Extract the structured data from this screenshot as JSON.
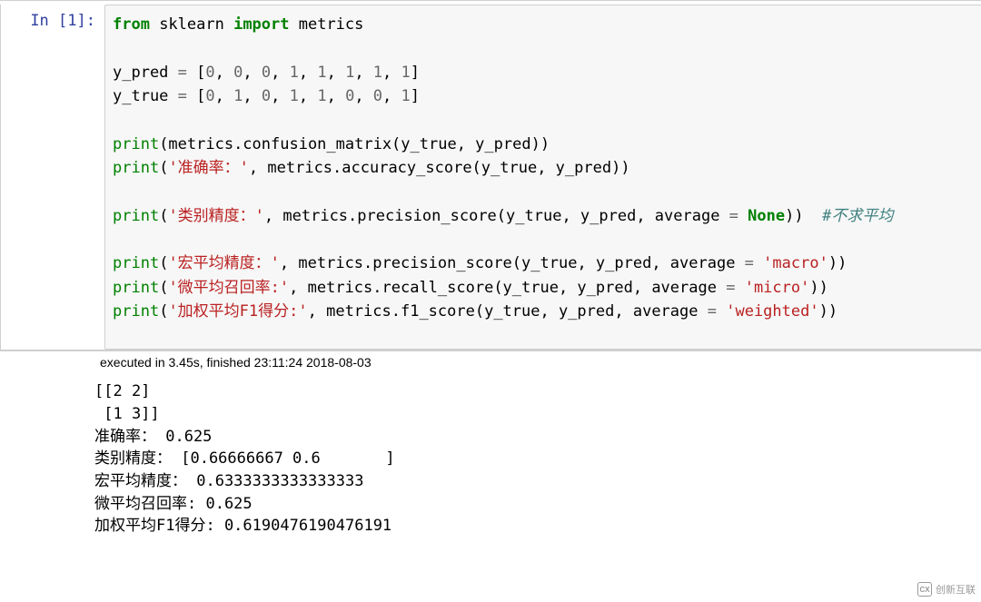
{
  "cell": {
    "prompt_label": "In",
    "prompt_number": "[1]:",
    "code_tokens": [
      {
        "cls": "kw-green",
        "t": "from"
      },
      {
        "cls": "plain",
        "t": " sklearn "
      },
      {
        "cls": "kw-green",
        "t": "import"
      },
      {
        "cls": "plain",
        "t": " metrics\n\n"
      },
      {
        "cls": "plain",
        "t": "y_pred "
      },
      {
        "cls": "op",
        "t": "="
      },
      {
        "cls": "plain",
        "t": " ["
      },
      {
        "cls": "op",
        "t": "0"
      },
      {
        "cls": "plain",
        "t": ", "
      },
      {
        "cls": "op",
        "t": "0"
      },
      {
        "cls": "plain",
        "t": ", "
      },
      {
        "cls": "op",
        "t": "0"
      },
      {
        "cls": "plain",
        "t": ", "
      },
      {
        "cls": "op",
        "t": "1"
      },
      {
        "cls": "plain",
        "t": ", "
      },
      {
        "cls": "op",
        "t": "1"
      },
      {
        "cls": "plain",
        "t": ", "
      },
      {
        "cls": "op",
        "t": "1"
      },
      {
        "cls": "plain",
        "t": ", "
      },
      {
        "cls": "op",
        "t": "1"
      },
      {
        "cls": "plain",
        "t": ", "
      },
      {
        "cls": "op",
        "t": "1"
      },
      {
        "cls": "plain",
        "t": "]\n"
      },
      {
        "cls": "plain",
        "t": "y_true "
      },
      {
        "cls": "op",
        "t": "="
      },
      {
        "cls": "plain",
        "t": " ["
      },
      {
        "cls": "op",
        "t": "0"
      },
      {
        "cls": "plain",
        "t": ", "
      },
      {
        "cls": "op",
        "t": "1"
      },
      {
        "cls": "plain",
        "t": ", "
      },
      {
        "cls": "op",
        "t": "0"
      },
      {
        "cls": "plain",
        "t": ", "
      },
      {
        "cls": "op",
        "t": "1"
      },
      {
        "cls": "plain",
        "t": ", "
      },
      {
        "cls": "op",
        "t": "1"
      },
      {
        "cls": "plain",
        "t": ", "
      },
      {
        "cls": "op",
        "t": "0"
      },
      {
        "cls": "plain",
        "t": ", "
      },
      {
        "cls": "op",
        "t": "0"
      },
      {
        "cls": "plain",
        "t": ", "
      },
      {
        "cls": "op",
        "t": "1"
      },
      {
        "cls": "plain",
        "t": "]\n\n"
      },
      {
        "cls": "builtin",
        "t": "print"
      },
      {
        "cls": "plain",
        "t": "(metrics.confusion_matrix(y_true, y_pred))\n"
      },
      {
        "cls": "builtin",
        "t": "print"
      },
      {
        "cls": "plain",
        "t": "("
      },
      {
        "cls": "str",
        "t": "'准确率：'"
      },
      {
        "cls": "plain",
        "t": ", metrics.accuracy_score(y_true, y_pred))\n\n"
      },
      {
        "cls": "builtin",
        "t": "print"
      },
      {
        "cls": "plain",
        "t": "("
      },
      {
        "cls": "str",
        "t": "'类别精度：'"
      },
      {
        "cls": "plain",
        "t": ", metrics.precision_score(y_true, y_pred, average "
      },
      {
        "cls": "op",
        "t": "="
      },
      {
        "cls": "plain",
        "t": " "
      },
      {
        "cls": "id-none",
        "t": "None"
      },
      {
        "cls": "plain",
        "t": "))  "
      },
      {
        "cls": "comment",
        "t": "#不求平均"
      },
      {
        "cls": "plain",
        "t": "\n\n"
      },
      {
        "cls": "builtin",
        "t": "print"
      },
      {
        "cls": "plain",
        "t": "("
      },
      {
        "cls": "str",
        "t": "'宏平均精度：'"
      },
      {
        "cls": "plain",
        "t": ", metrics.precision_score(y_true, y_pred, average "
      },
      {
        "cls": "op",
        "t": "="
      },
      {
        "cls": "plain",
        "t": " "
      },
      {
        "cls": "str",
        "t": "'macro'"
      },
      {
        "cls": "plain",
        "t": "))\n"
      },
      {
        "cls": "builtin",
        "t": "print"
      },
      {
        "cls": "plain",
        "t": "("
      },
      {
        "cls": "str",
        "t": "'微平均召回率:'"
      },
      {
        "cls": "plain",
        "t": ", metrics.recall_score(y_true, y_pred, average "
      },
      {
        "cls": "op",
        "t": "="
      },
      {
        "cls": "plain",
        "t": " "
      },
      {
        "cls": "str",
        "t": "'micro'"
      },
      {
        "cls": "plain",
        "t": "))\n"
      },
      {
        "cls": "builtin",
        "t": "print"
      },
      {
        "cls": "plain",
        "t": "("
      },
      {
        "cls": "str",
        "t": "'加权平均F1得分:'"
      },
      {
        "cls": "plain",
        "t": ", metrics.f1_score(y_true, y_pred, average "
      },
      {
        "cls": "op",
        "t": "="
      },
      {
        "cls": "plain",
        "t": " "
      },
      {
        "cls": "str",
        "t": "'weighted'"
      },
      {
        "cls": "plain",
        "t": "))"
      }
    ]
  },
  "exec_bar": "executed in 3.45s, finished 23:11:24 2018-08-03",
  "output": "[[2 2]\n [1 3]]\n准确率： 0.625\n类别精度： [0.66666667 0.6       ]\n宏平均精度： 0.6333333333333333\n微平均召回率: 0.625\n加权平均F1得分: 0.6190476190476191",
  "watermark": {
    "logo_text": "CX",
    "text": "创新互联"
  }
}
